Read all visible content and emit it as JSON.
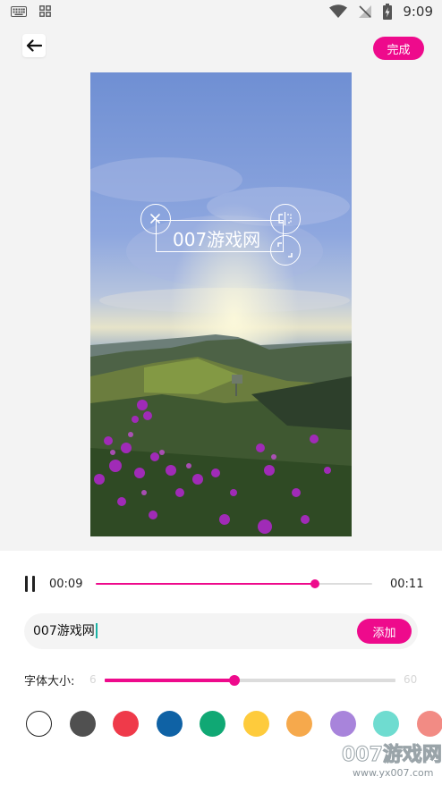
{
  "status_bar": {
    "time": "9:09",
    "icons": [
      "keyboard-icon",
      "apps-grid-icon",
      "wifi-icon",
      "signal-off-icon",
      "battery-charging-icon"
    ]
  },
  "header": {
    "back_icon": "arrow-left-icon",
    "done_label": "完成"
  },
  "preview": {
    "overlay_text": "007游戏网",
    "handles": [
      "delete-handle",
      "mirror-handle",
      "resize-handle"
    ]
  },
  "playback": {
    "current_time": "00:09",
    "total_time": "00:11",
    "progress": 0.792
  },
  "text_input": {
    "value": "007游戏网"
  },
  "add_label": "添加",
  "font_size": {
    "label": "字体大小:",
    "min": "6",
    "max": "60",
    "value_fraction": 0.446
  },
  "colors": [
    "#ffffff",
    "#505050",
    "#ef3a4a",
    "#0f62a5",
    "#10a874",
    "#fecb3c",
    "#f6a94c",
    "#a884db",
    "#6fdcd0",
    "#f28b84"
  ],
  "watermark": {
    "title": "007游戏网",
    "url": "www.yx007.com"
  }
}
